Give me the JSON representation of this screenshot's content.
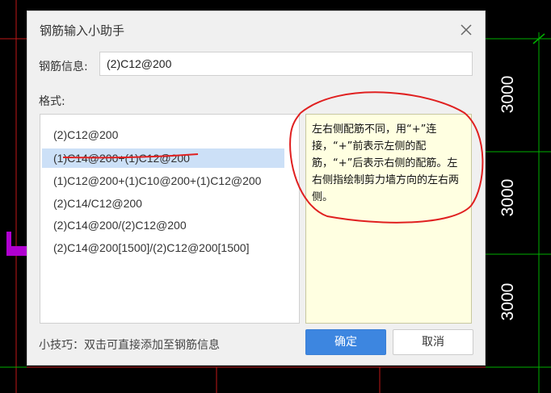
{
  "background": {
    "dimension_labels": [
      "3000",
      "3000",
      "3000"
    ],
    "colors": {
      "grid_red": "#c01818",
      "grid_green": "#00b000",
      "mark_magenta": "#b000d0"
    }
  },
  "dialog": {
    "title": "钢筋输入小助手",
    "close_icon": "close-icon",
    "info_label": "钢筋信息:",
    "info_value": "(2)C12@200",
    "format_label": "格式:",
    "formats": [
      "(2)C12@200",
      "(1)C14@200+(1)C12@200",
      "(1)C12@200+(1)C10@200+(1)C12@200",
      "(2)C14/C12@200",
      "(2)C14@200/(2)C12@200",
      "(2)C14@200[1500]/(2)C12@200[1500]"
    ],
    "selected_index": 1,
    "description": "左右侧配筋不同，用“+”连接，“+”前表示左侧的配筋，“+”后表示右侧的配筋。左右侧指绘制剪力墙方向的左右两侧。",
    "tip": "小技巧：双击可直接添加至钢筋信息",
    "ok_label": "确定",
    "cancel_label": "取消",
    "colors": {
      "accent": "#3d86e0",
      "selected_row": "#cce0f7",
      "desc_bg": "#ffffe1"
    }
  }
}
